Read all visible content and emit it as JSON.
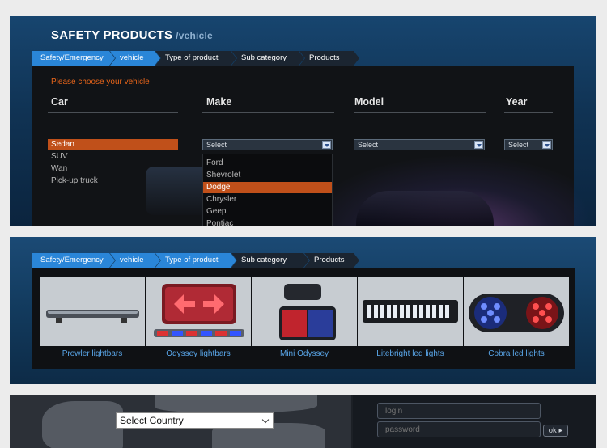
{
  "header": {
    "title": "SAFETY PRODUCTS",
    "subtitle": "/vehicle"
  },
  "breadcrumb_top": [
    "Safety/Emergency",
    "vehicle",
    "Type of product",
    "Sub category",
    "Products"
  ],
  "breadcrumb_products": [
    "Safety/Emergency",
    "vehicle",
    "Type of product",
    "Sub category",
    "Products"
  ],
  "chooser": {
    "prompt": "Please choose your vehicle",
    "columns": [
      "Car",
      "Make",
      "Model",
      "Year"
    ],
    "car_types": [
      "Sedan",
      "SUV",
      "Wan",
      "Pick-up truck"
    ],
    "selected_car": "Sedan",
    "make_select": "Select",
    "model_select": "Select",
    "year_select": "Select",
    "make_options": [
      "Ford",
      "Shevrolet",
      "Dodge",
      "Chrysler",
      "Geep",
      "Pontiac"
    ],
    "highlighted_make": "Dodge"
  },
  "products": [
    {
      "name": "Prowler lightbars",
      "icon": "lightbar-icon"
    },
    {
      "name": "Odyssey lightbars",
      "icon": "arrow-lightbar-icon"
    },
    {
      "name": "Mini Odyssey",
      "icon": "mini-light-icon"
    },
    {
      "name": "Litebright led lights",
      "icon": "led-bar-icon"
    },
    {
      "name": "Cobra led lights",
      "icon": "cobra-light-icon"
    }
  ],
  "footer": {
    "country_select": "Select Country",
    "login_placeholder": "login",
    "password_placeholder": "password",
    "ok_label": "ok",
    "ok_arrow": "▸"
  },
  "colors": {
    "accent_orange": "#c0501a",
    "crumb_active": "#2a86d8",
    "link_blue": "#5aa7ea"
  }
}
